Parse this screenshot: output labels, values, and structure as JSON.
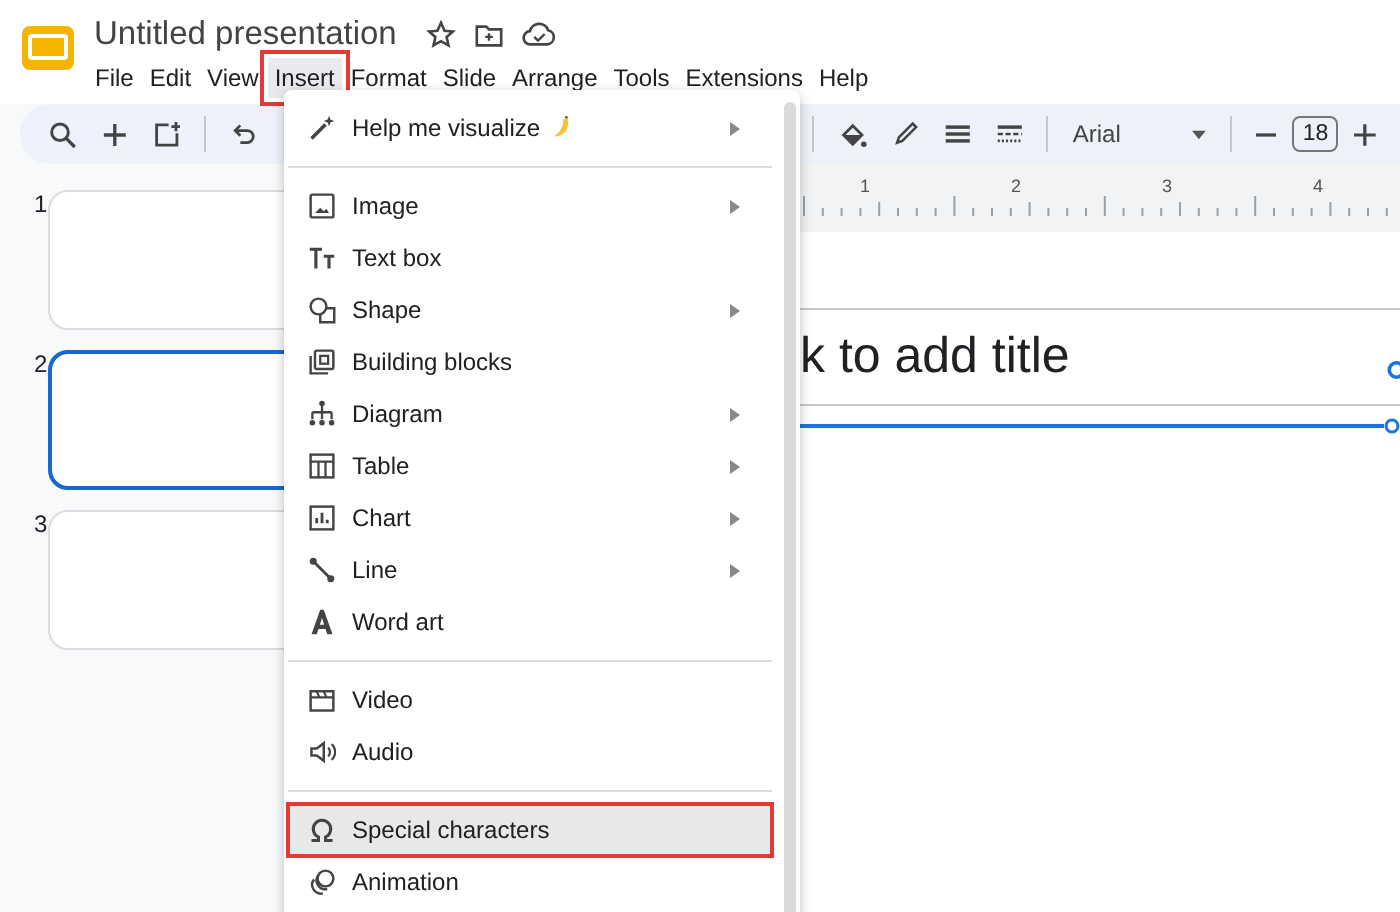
{
  "app": {
    "title": "Untitled presentation"
  },
  "menubar": [
    {
      "label": "File",
      "selected": false,
      "highlighted": false
    },
    {
      "label": "Edit",
      "selected": false,
      "highlighted": false
    },
    {
      "label": "View",
      "selected": false,
      "highlighted": false
    },
    {
      "label": "Insert",
      "selected": true,
      "highlighted": true
    },
    {
      "label": "Format",
      "selected": false,
      "highlighted": false
    },
    {
      "label": "Slide",
      "selected": false,
      "highlighted": false
    },
    {
      "label": "Arrange",
      "selected": false,
      "highlighted": false
    },
    {
      "label": "Tools",
      "selected": false,
      "highlighted": false
    },
    {
      "label": "Extensions",
      "selected": false,
      "highlighted": false
    },
    {
      "label": "Help",
      "selected": false,
      "highlighted": false
    }
  ],
  "toolbar": {
    "font": "Arial",
    "font_size": "18"
  },
  "ruler": [
    "1",
    "2",
    "3",
    "4"
  ],
  "slides": [
    {
      "number": "1",
      "selected": false
    },
    {
      "number": "2",
      "selected": true
    },
    {
      "number": "3",
      "selected": false
    }
  ],
  "slide": {
    "title_placeholder": "k to add title"
  },
  "insert_menu": {
    "items": [
      {
        "kind": "item",
        "label": "Help me visualize",
        "submenu": true,
        "selected": false,
        "highlighted": false
      },
      {
        "kind": "divider"
      },
      {
        "kind": "item",
        "label": "Image",
        "submenu": true,
        "selected": false,
        "highlighted": false
      },
      {
        "kind": "item",
        "label": "Text box",
        "submenu": false,
        "selected": false,
        "highlighted": false
      },
      {
        "kind": "item",
        "label": "Shape",
        "submenu": true,
        "selected": false,
        "highlighted": false
      },
      {
        "kind": "item",
        "label": "Building blocks",
        "submenu": false,
        "selected": false,
        "highlighted": false
      },
      {
        "kind": "item",
        "label": "Diagram",
        "submenu": true,
        "selected": false,
        "highlighted": false
      },
      {
        "kind": "item",
        "label": "Table",
        "submenu": true,
        "selected": false,
        "highlighted": false
      },
      {
        "kind": "item",
        "label": "Chart",
        "submenu": true,
        "selected": false,
        "highlighted": false
      },
      {
        "kind": "item",
        "label": "Line",
        "submenu": true,
        "selected": false,
        "highlighted": false
      },
      {
        "kind": "item",
        "label": "Word art",
        "submenu": false,
        "selected": false,
        "highlighted": false
      },
      {
        "kind": "divider"
      },
      {
        "kind": "item",
        "label": "Video",
        "submenu": false,
        "selected": false,
        "highlighted": false
      },
      {
        "kind": "item",
        "label": "Audio",
        "submenu": false,
        "selected": false,
        "highlighted": false
      },
      {
        "kind": "divider"
      },
      {
        "kind": "item",
        "label": "Special characters",
        "submenu": false,
        "selected": true,
        "highlighted": true
      },
      {
        "kind": "item",
        "label": "Animation",
        "submenu": false,
        "selected": false,
        "highlighted": false
      }
    ]
  }
}
